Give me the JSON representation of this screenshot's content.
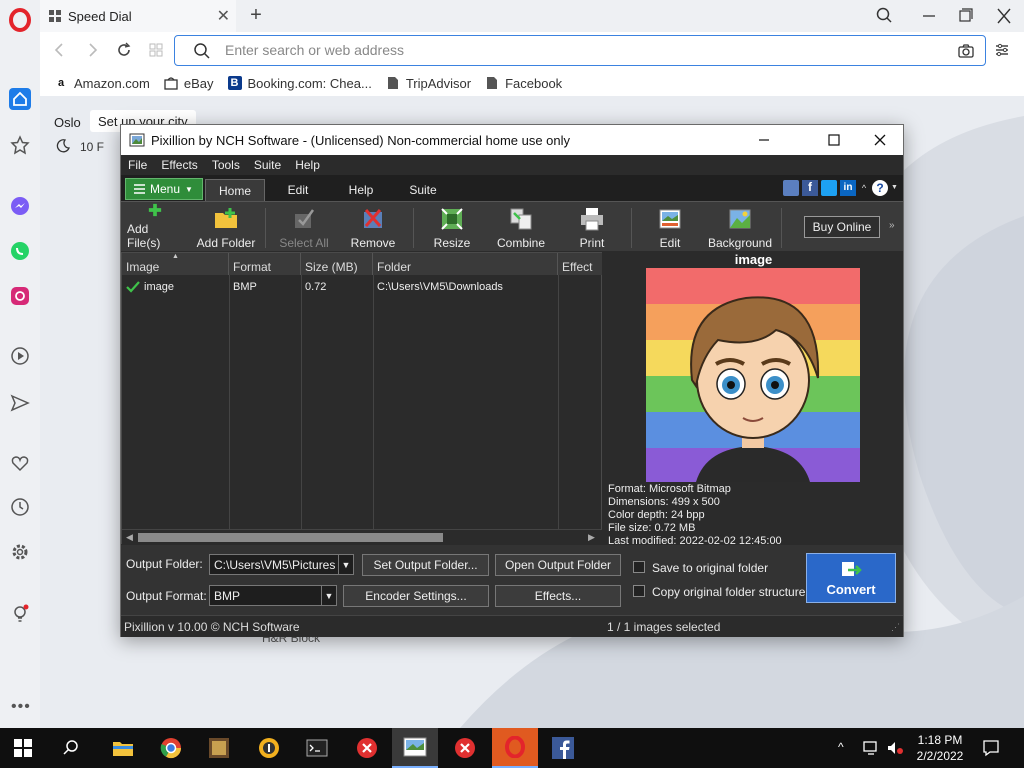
{
  "browser": {
    "tab_title": "Speed Dial",
    "address_placeholder": "Enter search or web address",
    "bookmarks": [
      {
        "label": "Amazon.com",
        "icon": "amazon-icon"
      },
      {
        "label": "eBay",
        "icon": "ebay-icon"
      },
      {
        "label": "Booking.com: Chea...",
        "icon": "booking-icon"
      },
      {
        "label": "TripAdvisor",
        "icon": "page-icon"
      },
      {
        "label": "Facebook",
        "icon": "page-icon"
      }
    ],
    "weather": {
      "city": "Oslo",
      "set_city": "Set up your city",
      "temp": "10 F"
    },
    "background_text": "H&R Block"
  },
  "app": {
    "title": "Pixillion by NCH Software - (Unlicensed) Non-commercial home use only",
    "menu": [
      "File",
      "Effects",
      "Tools",
      "Suite",
      "Help"
    ],
    "ribbon_tabs": {
      "menu": "Menu",
      "home": "Home",
      "edit": "Edit",
      "help": "Help",
      "suite": "Suite"
    },
    "ribbon": {
      "add_files": "Add File(s)",
      "add_folder": "Add Folder",
      "select_all": "Select All",
      "remove": "Remove",
      "resize": "Resize",
      "combine": "Combine",
      "print": "Print",
      "edit": "Edit",
      "background": "Background",
      "buy_online": "Buy Online"
    },
    "columns": [
      "Image",
      "Format",
      "Size (MB)",
      "Folder",
      "Effect"
    ],
    "files": [
      {
        "name": "image",
        "format": "BMP",
        "size": "0.72",
        "folder": "C:\\Users\\VM5\\Downloads"
      }
    ],
    "preview": {
      "title": "image",
      "format": "Format: Microsoft Bitmap",
      "dimensions": "Dimensions: 499 x 500",
      "color_depth": "Color depth: 24 bpp",
      "file_size": "File size: 0.72 MB",
      "last_modified": "Last modified: 2022-02-02 12:45:00"
    },
    "output": {
      "folder_label": "Output Folder:",
      "folder_value": "C:\\Users\\VM5\\Pictures",
      "format_label": "Output Format:",
      "format_value": "BMP",
      "set_output_folder": "Set Output Folder...",
      "open_output_folder": "Open Output Folder",
      "encoder_settings": "Encoder Settings...",
      "effects": "Effects...",
      "save_original": "Save to original folder",
      "copy_structure": "Copy original folder structure",
      "convert": "Convert"
    },
    "status": {
      "version": "Pixillion v 10.00 © NCH Software",
      "selection": "1 / 1 images selected"
    }
  },
  "taskbar": {
    "time": "1:18 PM",
    "date": "2/2/2022"
  },
  "colors": {
    "opera_red": "#e3242b",
    "app_bg": "#2b2b2b",
    "convert_blue": "#2a68c9",
    "menu_green": "#2f8d3a",
    "address_border": "#3b82e0"
  }
}
